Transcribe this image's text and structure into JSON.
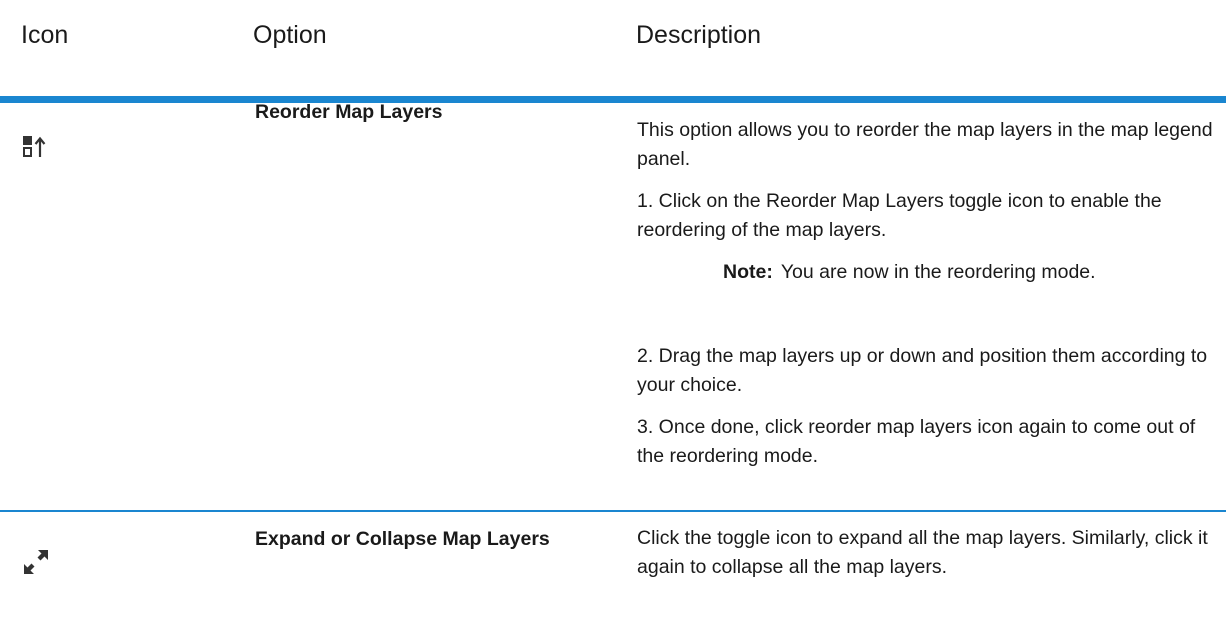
{
  "table": {
    "headers": {
      "icon": "Icon",
      "option": "Option",
      "description": "Description"
    },
    "rows": [
      {
        "icon": "reorder-layers-icon",
        "option": "Reorder Map Layers",
        "description": {
          "intro": "This option allows you to reorder the map layers in the map legend panel.",
          "step1": "1. Click on the Reorder Map Layers toggle icon to enable the reordering of the map layers.",
          "note_label": "Note:",
          "note_text": "You are now in the reordering mode.",
          "step2": "2. Drag the map layers up or down and position them according to your choice.",
          "step3": "3. Once done, click reorder map layers icon again to come out of the reordering mode."
        }
      },
      {
        "icon": "expand-collapse-icon",
        "option": "Expand or Collapse Map Layers",
        "description": {
          "text": "Click the toggle icon to expand all the map layers. Similarly, click it again to collapse all the map layers."
        }
      }
    ]
  },
  "colors": {
    "rule": "#1a86d0",
    "text": "#1a1a1a"
  }
}
